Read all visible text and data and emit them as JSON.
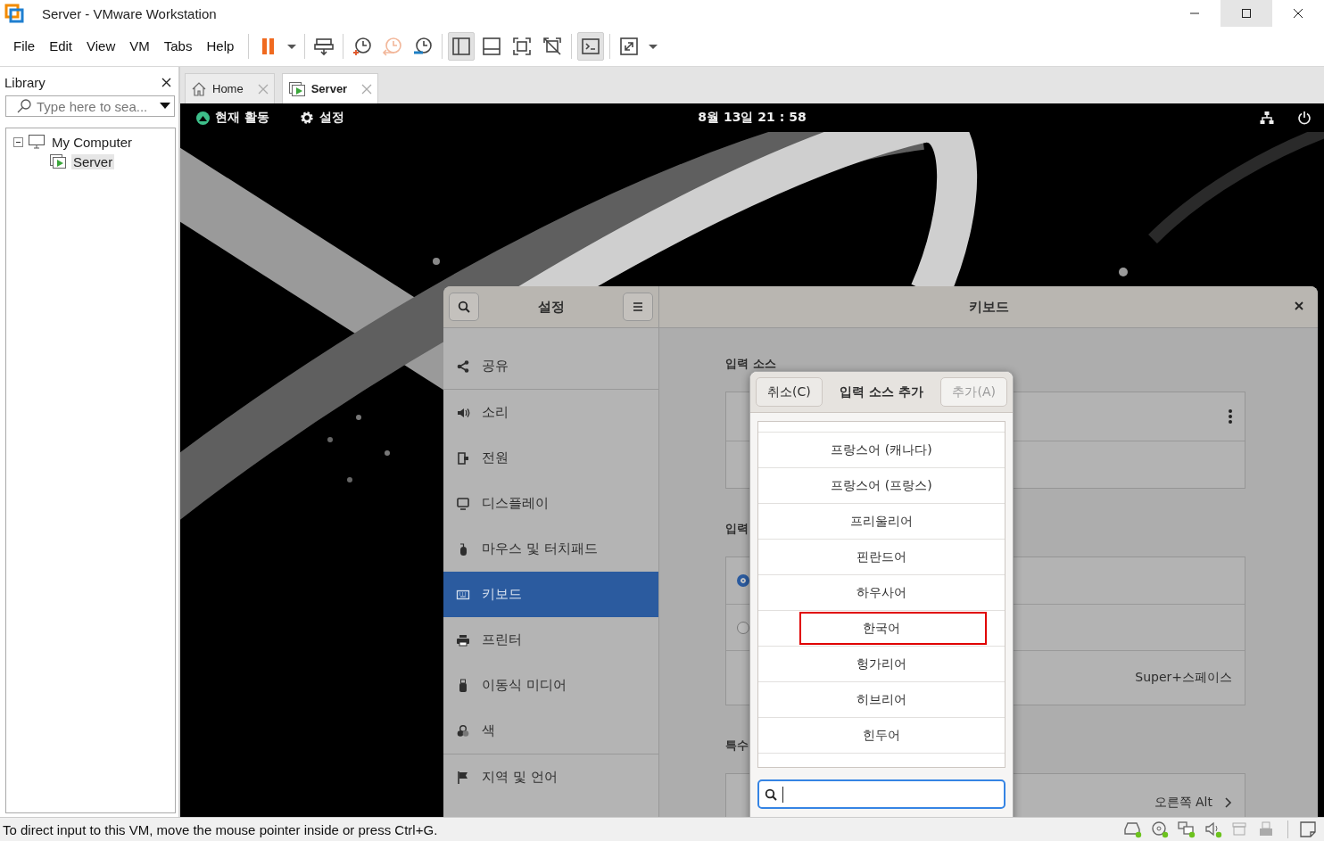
{
  "window": {
    "title": "Server - VMware Workstation"
  },
  "menu": [
    "File",
    "Edit",
    "View",
    "VM",
    "Tabs",
    "Help"
  ],
  "toolbar_groups": [
    {
      "buttons": [
        {
          "kind": "pause",
          "pressed": false
        },
        {
          "kind": "dropdown",
          "pressed": false
        }
      ]
    },
    {
      "buttons": [
        {
          "kind": "send",
          "pressed": false
        }
      ]
    },
    {
      "buttons": [
        {
          "kind": "snapshot",
          "pressed": false
        },
        {
          "kind": "revert",
          "pressed": false
        },
        {
          "kind": "manage",
          "pressed": false
        }
      ]
    },
    {
      "buttons": [
        {
          "kind": "library",
          "pressed": true
        },
        {
          "kind": "thumbnails",
          "pressed": false
        },
        {
          "kind": "fullscreen",
          "pressed": false
        },
        {
          "kind": "unity",
          "pressed": false
        }
      ]
    },
    {
      "buttons": [
        {
          "kind": "console",
          "pressed": true
        }
      ]
    },
    {
      "buttons": [
        {
          "kind": "stretch",
          "pressed": false
        },
        {
          "kind": "dropdown",
          "pressed": false
        }
      ]
    }
  ],
  "library": {
    "title": "Library",
    "search": {
      "placeholder": "Type here to sea..."
    },
    "tree": [
      {
        "label": "My Computer",
        "selected": false,
        "expanded": true,
        "children": [
          {
            "label": "Server",
            "selected": true
          }
        ]
      }
    ]
  },
  "tabs": [
    {
      "label": "Home",
      "kind": "home",
      "selected": false
    },
    {
      "label": "Server",
      "kind": "vm",
      "selected": true
    }
  ],
  "guest": {
    "top_bar": {
      "activities": "현재 활동",
      "app": "설정",
      "clock": "8월 13일 21 : 58"
    },
    "settings": {
      "title": "설정",
      "page_title": "키보드",
      "sidebar": [
        {
          "kind": "share",
          "label": "공유",
          "selected": false
        },
        {
          "kind": "sound",
          "label": "소리",
          "selected": false
        },
        {
          "kind": "power",
          "label": "전원",
          "selected": false
        },
        {
          "kind": "display",
          "label": "디스플레이",
          "selected": false
        },
        {
          "kind": "mouse",
          "label": "마우스 및 터치패드",
          "selected": false
        },
        {
          "kind": "keyboard",
          "label": "키보드",
          "selected": true
        },
        {
          "kind": "printer",
          "label": "프린터",
          "selected": false
        },
        {
          "kind": "usb",
          "label": "이동식 미디어",
          "selected": false
        },
        {
          "kind": "color",
          "label": "색",
          "selected": false
        },
        {
          "kind": "flag",
          "label": "지역 및 언어",
          "selected": false
        }
      ],
      "headings": [
        "입력 소스",
        "입력",
        "특수"
      ],
      "input_modes": [
        {
          "selected": true
        },
        {
          "selected": false
        }
      ],
      "shortcut": "Super+스페이스",
      "special_key": "오른쪽 Alt"
    },
    "dialog": {
      "cancel": "취소(C)",
      "title": "입력 소스 추가",
      "add": {
        "label": "추가(A)",
        "disabled": true
      },
      "languages": [
        {
          "label": "프랑스어 (캐나다)",
          "highlighted": false
        },
        {
          "label": "프랑스어 (프랑스)",
          "highlighted": false
        },
        {
          "label": "프리울리어",
          "highlighted": false
        },
        {
          "label": "핀란드어",
          "highlighted": false
        },
        {
          "label": "하우사어",
          "highlighted": false
        },
        {
          "label": "한국어",
          "highlighted": true
        },
        {
          "label": "헝가리어",
          "highlighted": false
        },
        {
          "label": "히브리어",
          "highlighted": false
        },
        {
          "label": "힌두어",
          "highlighted": false
        }
      ]
    }
  },
  "status_bar": {
    "message": "To direct input to this VM, move the mouse pointer inside or press Ctrl+G.",
    "devices": [
      {
        "kind": "disk",
        "active": true
      },
      {
        "kind": "cd",
        "active": true
      },
      {
        "kind": "network",
        "active": true
      },
      {
        "kind": "sound",
        "active": true
      },
      {
        "kind": "archive",
        "active": false
      },
      {
        "kind": "usb",
        "active": false
      }
    ]
  }
}
